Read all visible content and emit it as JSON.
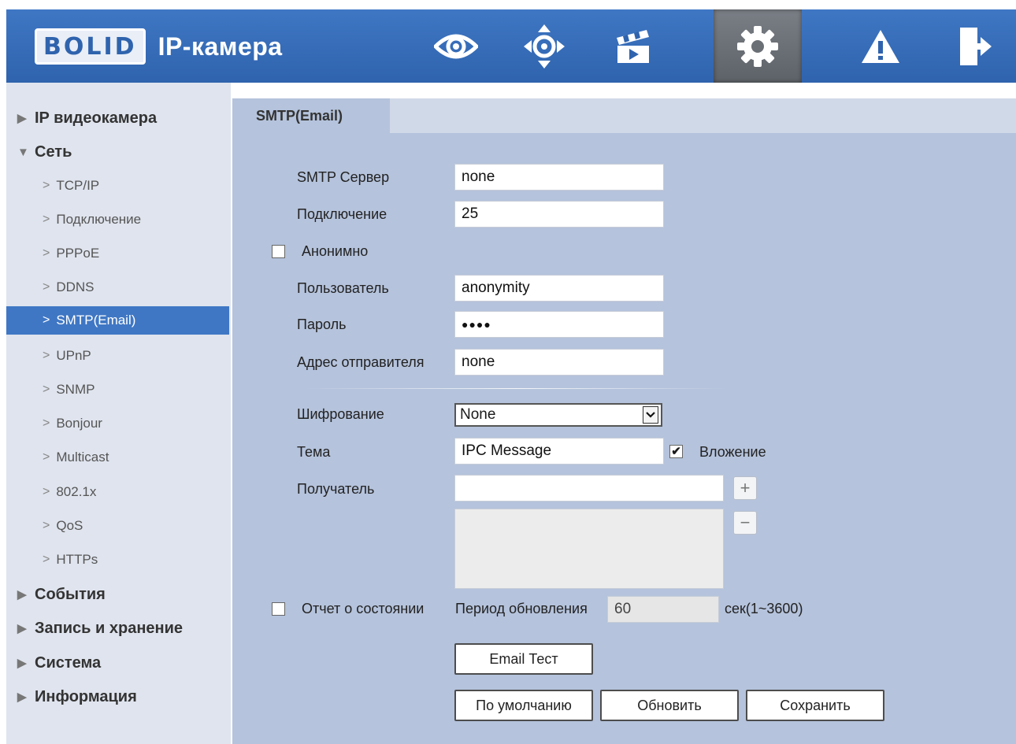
{
  "app": {
    "logo": "BOLID",
    "title": "IP-камера"
  },
  "topnav": [
    "live-view",
    "ptz",
    "playback",
    "settings",
    "alarm",
    "logout"
  ],
  "sidebar": {
    "ip_camera": "IP видеокамера",
    "network": "Сеть",
    "network_items": [
      "TCP/IP",
      "Подключение",
      "PPPoE",
      "DDNS",
      "SMTP(Email)",
      "UPnP",
      "SNMP",
      "Bonjour",
      "Multicast",
      "802.1x",
      "QoS",
      "HTTPs"
    ],
    "events": "События",
    "record": "Запись и хранение",
    "system": "Система",
    "info": "Информация"
  },
  "tab": "SMTP(Email)",
  "form": {
    "smtp_server_label": "SMTP Сервер",
    "smtp_server_value": "none",
    "port_label": "Подключение",
    "port_value": "25",
    "anonymous_label": "Анонимно",
    "anonymous_checked": false,
    "user_label": "Пользователь",
    "user_value": "anonymity",
    "password_label": "Пароль",
    "password_mask": "●●●●",
    "sender_label": "Адрес отправителя",
    "sender_value": "none",
    "encryption_label": "Шифрование",
    "encryption_value": "None",
    "subject_label": "Тема",
    "subject_value": "IPC Message",
    "attachment_label": "Вложение",
    "attachment_checked": true,
    "recipient_label": "Получатель",
    "recipient_value": "",
    "status_report_label": "Отчет о состоянии",
    "status_report_checked": false,
    "update_period_label": "Период обновления",
    "update_period_value": "60",
    "update_period_unit": "сек(1~3600)"
  },
  "buttons": {
    "email_test": "Email Тест",
    "default": "По умолчанию",
    "refresh": "Обновить",
    "save": "Сохранить"
  },
  "colors": {
    "header": "#3f77c4",
    "sidebar": "#dfe4ee",
    "content": "#b5c3dc",
    "selected": "#3f77c4"
  }
}
